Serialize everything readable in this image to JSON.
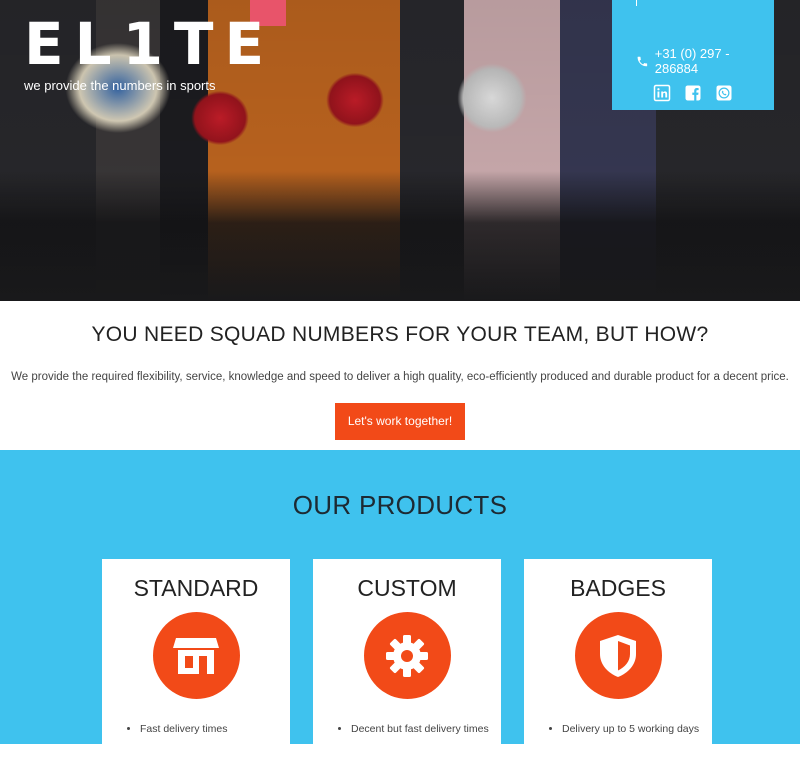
{
  "brand": {
    "logo": "EL1TE",
    "tagline": "we provide the numbers in sports"
  },
  "contact": {
    "phone": "+31 (0) 297 - 286884",
    "icons": [
      "phone-icon",
      "linkedin-icon",
      "facebook-icon",
      "whatsapp-icon"
    ]
  },
  "intro": {
    "heading": "YOU NEED SQUAD NUMBERS FOR YOUR TEAM, BUT HOW?",
    "text": "We provide the required flexibility, service, knowledge and speed to deliver a high quality, eco-efficiently produced and durable product for a decent price.",
    "cta_label": "Let's work together!"
  },
  "products": {
    "heading": "OUR PRODUCTS",
    "cards": [
      {
        "title": "STANDARD",
        "icon": "storefront-icon",
        "items": [
          "Fast delivery times"
        ]
      },
      {
        "title": "CUSTOM",
        "icon": "gear-icon",
        "items": [
          "Decent but fast delivery times"
        ]
      },
      {
        "title": "BADGES",
        "icon": "shield-icon",
        "items": [
          "Delivery up to 5 working days"
        ]
      }
    ]
  },
  "colors": {
    "accent_blue": "#3fc2ee",
    "accent_orange": "#f24a18"
  }
}
